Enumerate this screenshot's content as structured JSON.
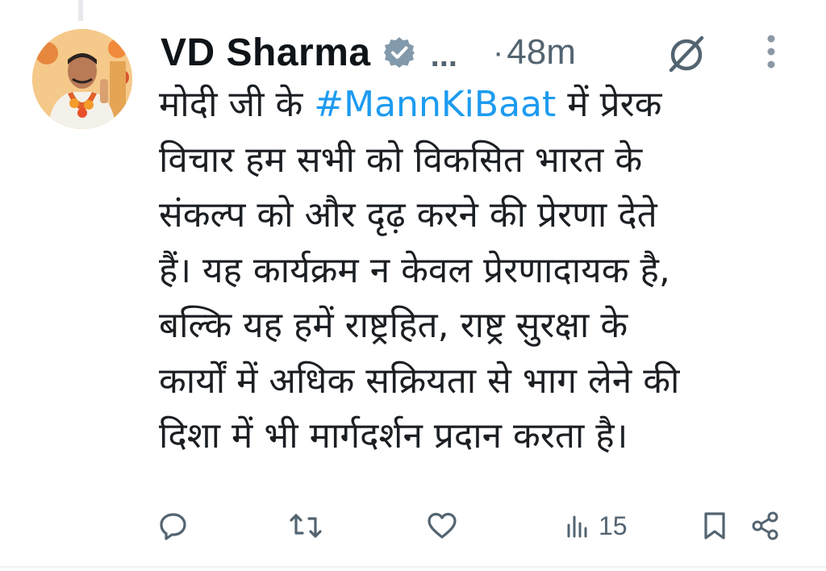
{
  "tweet": {
    "author": {
      "display_name": "VD Sharma",
      "verified": true,
      "handle_truncated": "...",
      "avatar_icon": "profile-photo"
    },
    "time_separator": "·",
    "timestamp": "48m",
    "text": {
      "line1_before": "मोदी जी के ",
      "hashtag": "#MannKiBaat",
      "line1_after": " में प्रेरक",
      "line2": "विचार हम सभी को विकसित भारत के",
      "line3": "संकल्प को और दृढ़ करने की प्रेरणा देते",
      "line4": "हैं। यह कार्यक्रम न केवल प्रेरणादायक है,",
      "line5": "बल्कि यह हमें राष्ट्रहित, राष्ट्र सुरक्षा के",
      "line6": "कार्यों में अधिक सक्रियता से भाग लेने की",
      "line7": "दिशा में भी मार्गदर्शन प्रदान करता है।"
    },
    "actions": {
      "reply_icon": "reply-icon",
      "retweet_icon": "retweet-icon",
      "like_icon": "like-icon",
      "views_icon": "views-icon",
      "views_count": "15",
      "bookmark_icon": "bookmark-icon",
      "share_icon": "share-icon"
    }
  },
  "colors": {
    "hashtag": "#1d9bf0",
    "muted": "#536471",
    "text": "#0f1419"
  }
}
